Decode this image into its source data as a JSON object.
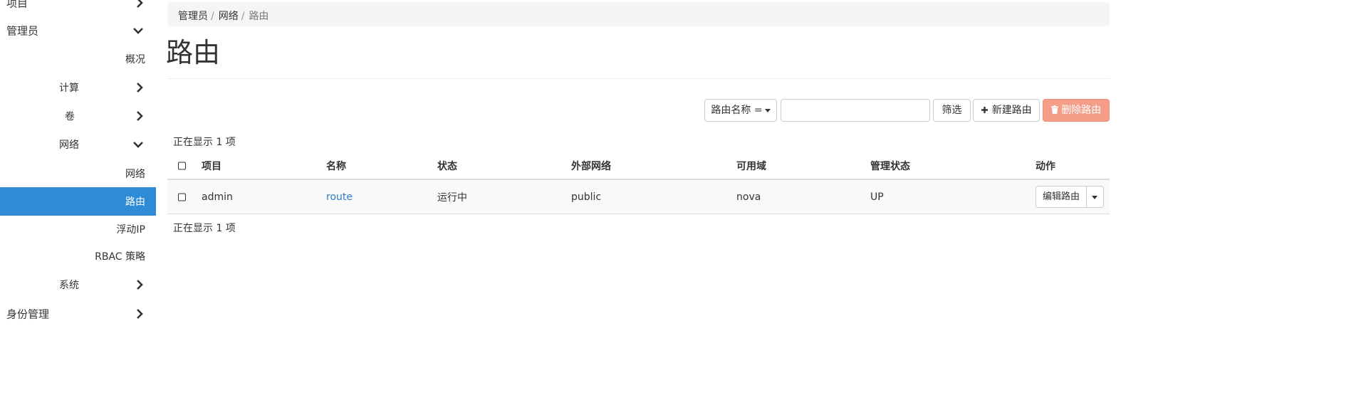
{
  "sidebar": {
    "project": "项目",
    "admin": "管理员",
    "overview": "概况",
    "compute": "计算",
    "volumes": "卷",
    "network_group": "网络",
    "networks": "网络",
    "routers": "路由",
    "floating_ip": "浮动IP",
    "rbac": "RBAC 策略",
    "system": "系统",
    "identity": "身份管理"
  },
  "breadcrumb": [
    "管理员",
    "网络",
    "路由"
  ],
  "page_title": "路由",
  "toolbar": {
    "filter_field": "路由名称 =",
    "filter_value": "",
    "filter_button": "筛选",
    "create_button": "新建路由",
    "delete_button": "删除路由"
  },
  "count_top": "正在显示 1 项",
  "count_bottom": "正在显示 1 项",
  "table": {
    "headers": [
      "项目",
      "名称",
      "状态",
      "外部网络",
      "可用域",
      "管理状态",
      "动作"
    ],
    "rows": [
      {
        "project": "admin",
        "name": "route",
        "status": "运行中",
        "external_network": "public",
        "availability_zone": "nova",
        "admin_state": "UP",
        "action": "编辑路由"
      }
    ]
  },
  "colors": {
    "active_nav": "#2f8bd6",
    "link": "#2a7fc9",
    "danger_button": "#f49d88"
  },
  "icons": [
    "chevron-right-icon",
    "chevron-down-icon",
    "plus-icon",
    "trash-icon",
    "caret-down-icon"
  ]
}
